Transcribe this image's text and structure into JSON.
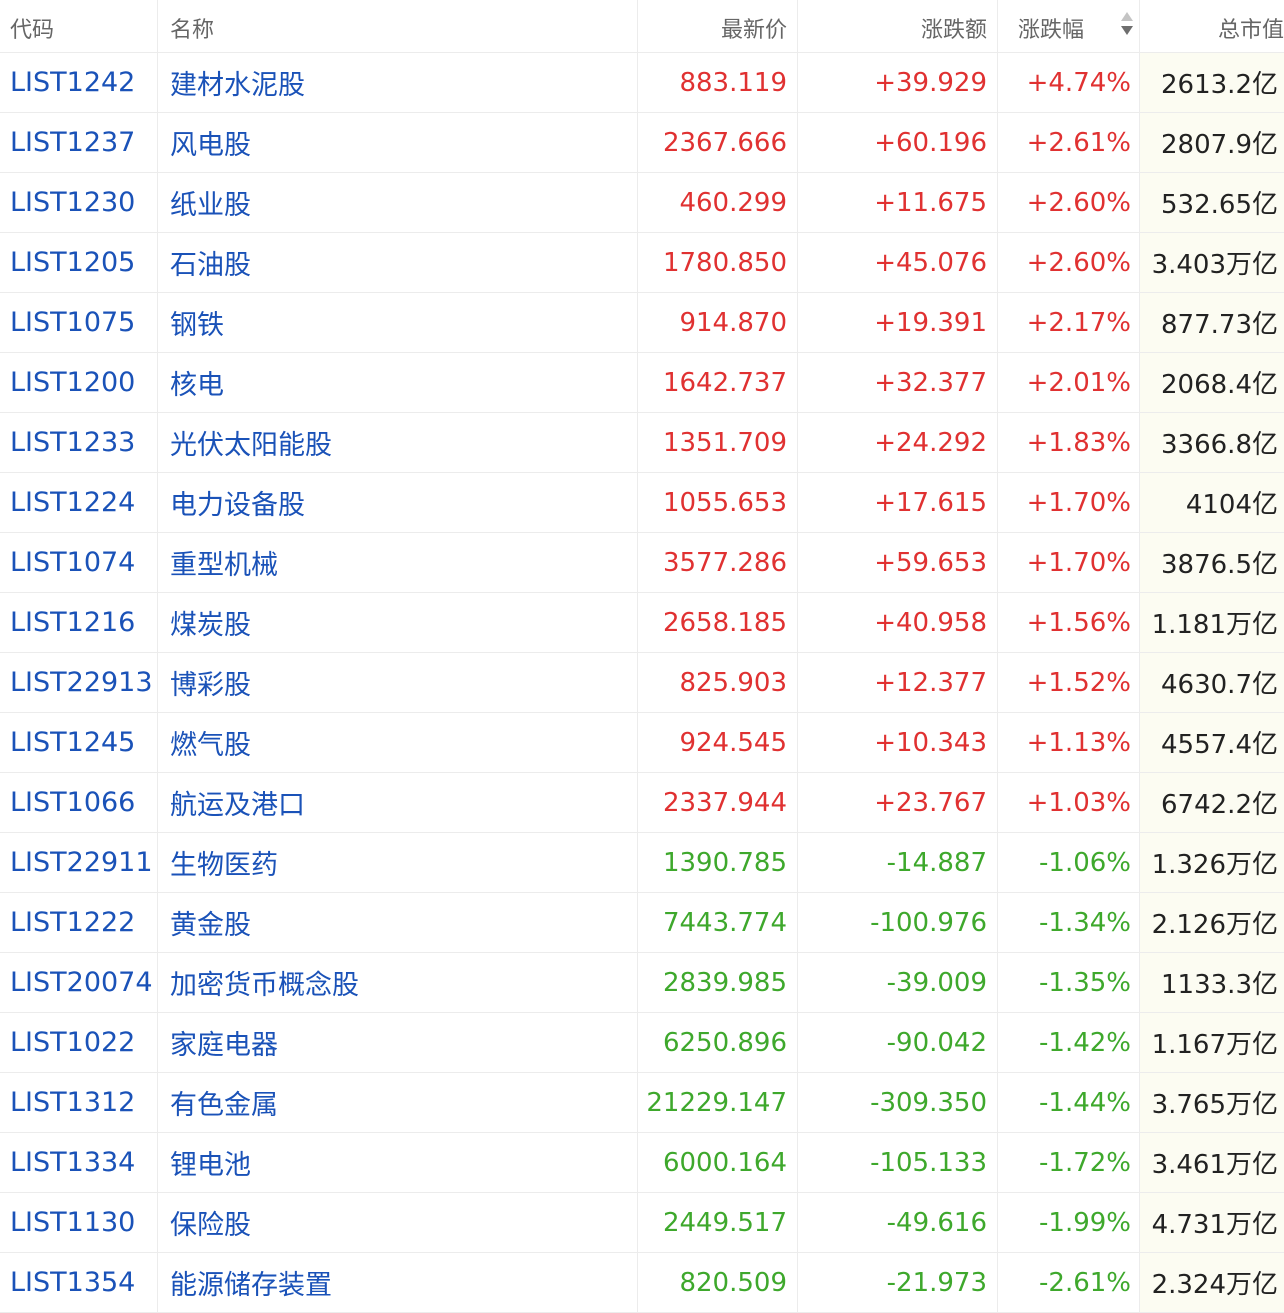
{
  "header": {
    "code": "代码",
    "name": "名称",
    "price": "最新价",
    "change": "涨跌额",
    "pct": "涨跌幅",
    "cap": "总市值"
  },
  "colors": {
    "up": "#e03131",
    "down": "#3ea82c",
    "link": "#1a52b8"
  },
  "sort_icon": "sort-up-down-icon",
  "rows": [
    {
      "code": "LIST1242",
      "name": "建材水泥股",
      "price": "883.119",
      "change": "+39.929",
      "pct": "+4.74%",
      "cap": "2613.2亿",
      "dir": "up"
    },
    {
      "code": "LIST1237",
      "name": "风电股",
      "price": "2367.666",
      "change": "+60.196",
      "pct": "+2.61%",
      "cap": "2807.9亿",
      "dir": "up"
    },
    {
      "code": "LIST1230",
      "name": "纸业股",
      "price": "460.299",
      "change": "+11.675",
      "pct": "+2.60%",
      "cap": "532.65亿",
      "dir": "up"
    },
    {
      "code": "LIST1205",
      "name": "石油股",
      "price": "1780.850",
      "change": "+45.076",
      "pct": "+2.60%",
      "cap": "3.403万亿",
      "dir": "up"
    },
    {
      "code": "LIST1075",
      "name": "钢铁",
      "price": "914.870",
      "change": "+19.391",
      "pct": "+2.17%",
      "cap": "877.73亿",
      "dir": "up"
    },
    {
      "code": "LIST1200",
      "name": "核电",
      "price": "1642.737",
      "change": "+32.377",
      "pct": "+2.01%",
      "cap": "2068.4亿",
      "dir": "up"
    },
    {
      "code": "LIST1233",
      "name": "光伏太阳能股",
      "price": "1351.709",
      "change": "+24.292",
      "pct": "+1.83%",
      "cap": "3366.8亿",
      "dir": "up"
    },
    {
      "code": "LIST1224",
      "name": "电力设备股",
      "price": "1055.653",
      "change": "+17.615",
      "pct": "+1.70%",
      "cap": "4104亿",
      "dir": "up"
    },
    {
      "code": "LIST1074",
      "name": "重型机械",
      "price": "3577.286",
      "change": "+59.653",
      "pct": "+1.70%",
      "cap": "3876.5亿",
      "dir": "up"
    },
    {
      "code": "LIST1216",
      "name": "煤炭股",
      "price": "2658.185",
      "change": "+40.958",
      "pct": "+1.56%",
      "cap": "1.181万亿",
      "dir": "up"
    },
    {
      "code": "LIST22913",
      "name": "博彩股",
      "price": "825.903",
      "change": "+12.377",
      "pct": "+1.52%",
      "cap": "4630.7亿",
      "dir": "up"
    },
    {
      "code": "LIST1245",
      "name": "燃气股",
      "price": "924.545",
      "change": "+10.343",
      "pct": "+1.13%",
      "cap": "4557.4亿",
      "dir": "up"
    },
    {
      "code": "LIST1066",
      "name": "航运及港口",
      "price": "2337.944",
      "change": "+23.767",
      "pct": "+1.03%",
      "cap": "6742.2亿",
      "dir": "up"
    },
    {
      "code": "LIST22911",
      "name": "生物医药",
      "price": "1390.785",
      "change": "-14.887",
      "pct": "-1.06%",
      "cap": "1.326万亿",
      "dir": "down"
    },
    {
      "code": "LIST1222",
      "name": "黄金股",
      "price": "7443.774",
      "change": "-100.976",
      "pct": "-1.34%",
      "cap": "2.126万亿",
      "dir": "down"
    },
    {
      "code": "LIST20074",
      "name": "加密货币概念股",
      "price": "2839.985",
      "change": "-39.009",
      "pct": "-1.35%",
      "cap": "1133.3亿",
      "dir": "down"
    },
    {
      "code": "LIST1022",
      "name": "家庭电器",
      "price": "6250.896",
      "change": "-90.042",
      "pct": "-1.42%",
      "cap": "1.167万亿",
      "dir": "down"
    },
    {
      "code": "LIST1312",
      "name": "有色金属",
      "price": "21229.147",
      "change": "-309.350",
      "pct": "-1.44%",
      "cap": "3.765万亿",
      "dir": "down"
    },
    {
      "code": "LIST1334",
      "name": "锂电池",
      "price": "6000.164",
      "change": "-105.133",
      "pct": "-1.72%",
      "cap": "3.461万亿",
      "dir": "down"
    },
    {
      "code": "LIST1130",
      "name": "保险股",
      "price": "2449.517",
      "change": "-49.616",
      "pct": "-1.99%",
      "cap": "4.731万亿",
      "dir": "down"
    },
    {
      "code": "LIST1354",
      "name": "能源储存装置",
      "price": "820.509",
      "change": "-21.973",
      "pct": "-2.61%",
      "cap": "2.324万亿",
      "dir": "down"
    }
  ]
}
